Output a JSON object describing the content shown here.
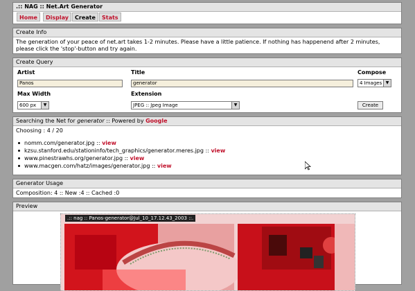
{
  "header": {
    "title": ".:: NAG :: Net.Art Generator"
  },
  "nav": [
    {
      "label": "Home",
      "active": true
    },
    {
      "label": "Display",
      "active": true
    },
    {
      "label": "Create",
      "active": false
    },
    {
      "label": "Stats",
      "active": true
    }
  ],
  "info": {
    "title": "Create Info",
    "text": "The generation of your peace of net.art takes 1-2 minutes. Please have a little patience. If nothing has happenend after 2 minutes, please click the 'stop'-button and try again."
  },
  "query": {
    "title": "Create Query",
    "artist_label": "Artist",
    "artist_value": "Panos",
    "title_label": "Title",
    "title_value": "generator",
    "compose_label": "Compose",
    "compose_value": "4 Images",
    "width_label": "Max Width",
    "width_value": "600 px",
    "ext_label": "Extension",
    "ext_value": "JPEG :: Jpeg Image",
    "create_button": "Create"
  },
  "search": {
    "prefix": "Searching the Net for ",
    "term": "generator",
    "middle": " :: Powered by ",
    "engine": "Google",
    "choosing": "Choosing : 4 / 20",
    "results": [
      {
        "url": "nomm.com/generator.jpg",
        "sep": " :: ",
        "link": "view"
      },
      {
        "url": "kzsu.stanford.edu/stationinfo/tech_graphics/generator.meres.jpg",
        "sep": " :: ",
        "link": "view"
      },
      {
        "url": "www.pinestrawhs.org/generator.jpg",
        "sep": " :: ",
        "link": "view"
      },
      {
        "url": "www.macgen.com/hatz/images/generator.jpg",
        "sep": " :: ",
        "link": "view"
      }
    ]
  },
  "usage": {
    "title": "Generator Usage",
    "text": "Composition: 4 :: New :4 :: Cached :0"
  },
  "preview": {
    "title": "Preview",
    "caption": ".:: nag :: Panos-generator@Jul_10_17.12.43_2003 ::."
  },
  "colors": {
    "accent": "#c0102a",
    "panel_head": "#e4e4e4",
    "background": "#a0a0a0",
    "input_bg": "#f5efdc"
  }
}
